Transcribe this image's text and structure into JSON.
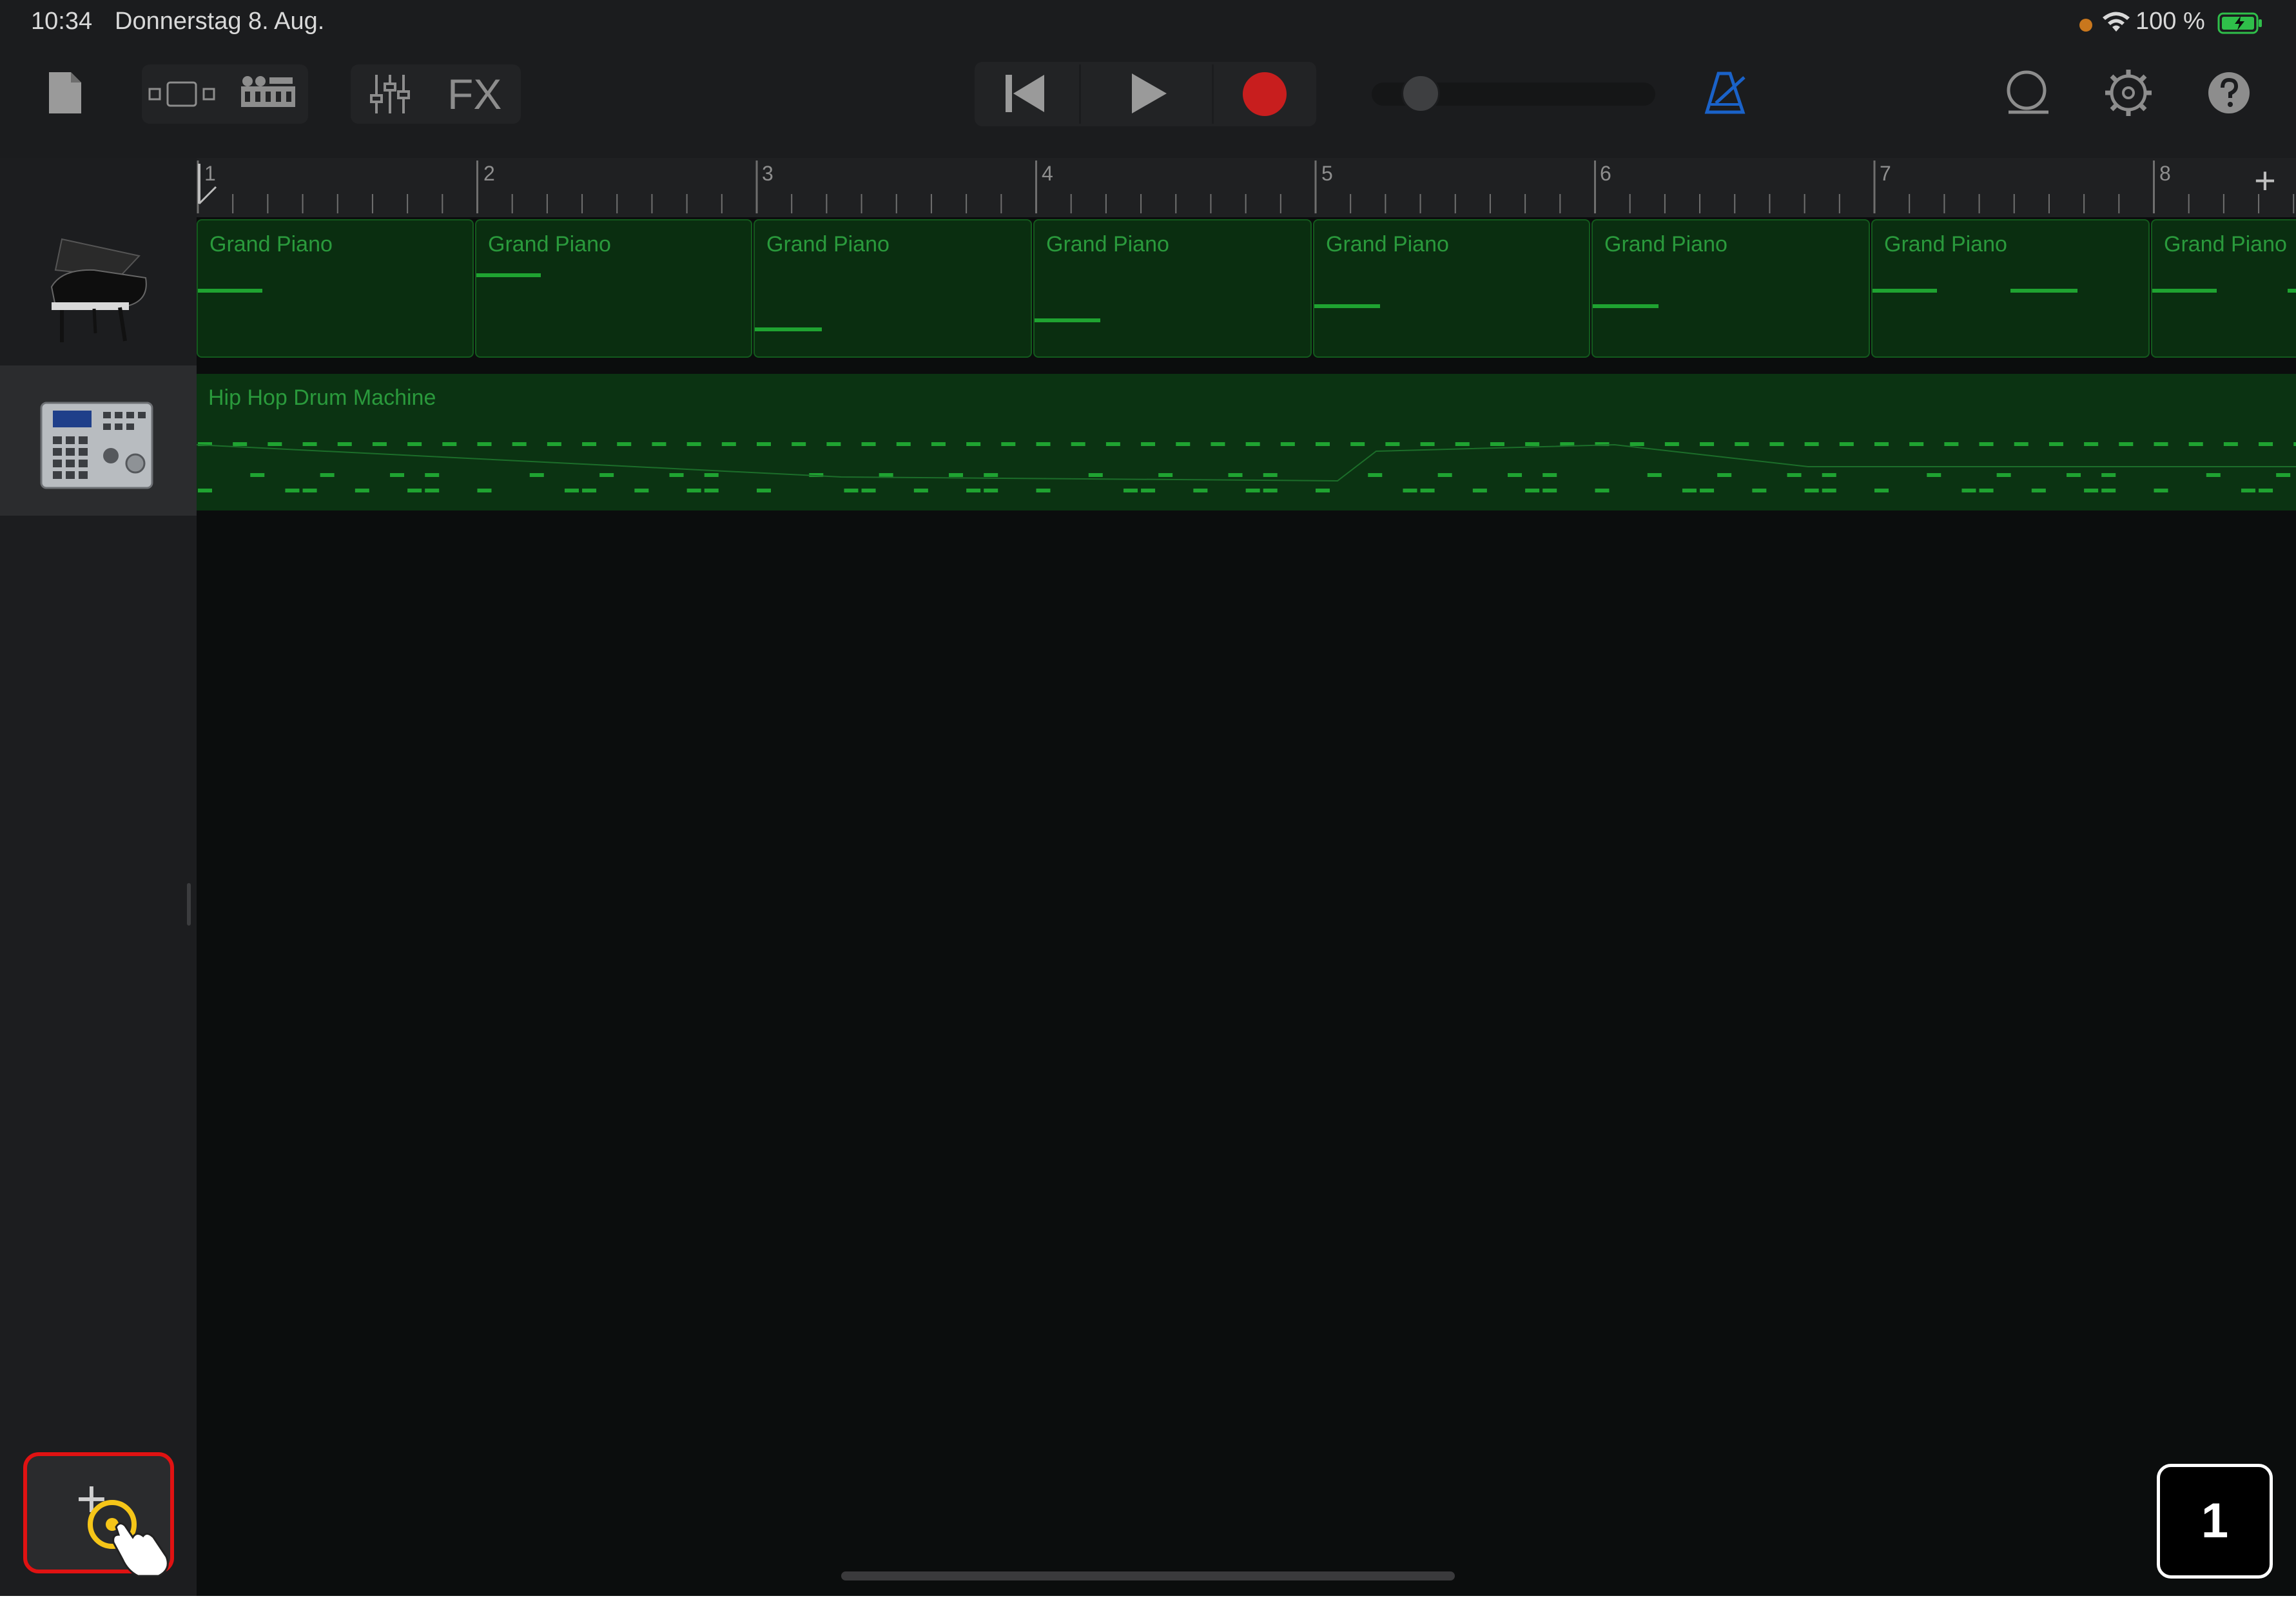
{
  "status_bar": {
    "time": "10:34",
    "date": "Donnerstag 8. Aug.",
    "battery": "100 %"
  },
  "toolbar": {
    "fx_label": "FX",
    "icons": [
      "document-icon",
      "tracks-view-icon",
      "loop-browser-icon",
      "mixer-icon",
      "fx-icon",
      "rewind-icon",
      "play-icon",
      "record-icon",
      "volume-slider",
      "metronome-icon",
      "loop-icon",
      "settings-icon",
      "help-icon"
    ],
    "volume_level": 0.0
  },
  "ruler": {
    "bars": [
      "1",
      "2",
      "3",
      "4",
      "5",
      "6",
      "7",
      "8"
    ],
    "add_label": "+"
  },
  "tracks": [
    {
      "name": "Grand Piano",
      "icon": "grand-piano-icon",
      "regions": [
        "Grand Piano",
        "Grand Piano",
        "Grand Piano",
        "Grand Piano",
        "Grand Piano",
        "Grand Piano",
        "Grand Piano",
        "Grand Piano"
      ]
    },
    {
      "name": "Hip Hop Drum Machine",
      "icon": "drum-machine-icon",
      "region_label": "Hip Hop Drum Machine"
    }
  ],
  "add_track": {
    "label": "+"
  },
  "page_badge": "1",
  "colors": {
    "region_fill": "#0a2e10",
    "region_border": "#135a1d",
    "note": "#1fa331",
    "record": "#c81e1e",
    "metronome": "#1a62c9",
    "highlight": "#e01212",
    "touch": "#f5c518"
  }
}
